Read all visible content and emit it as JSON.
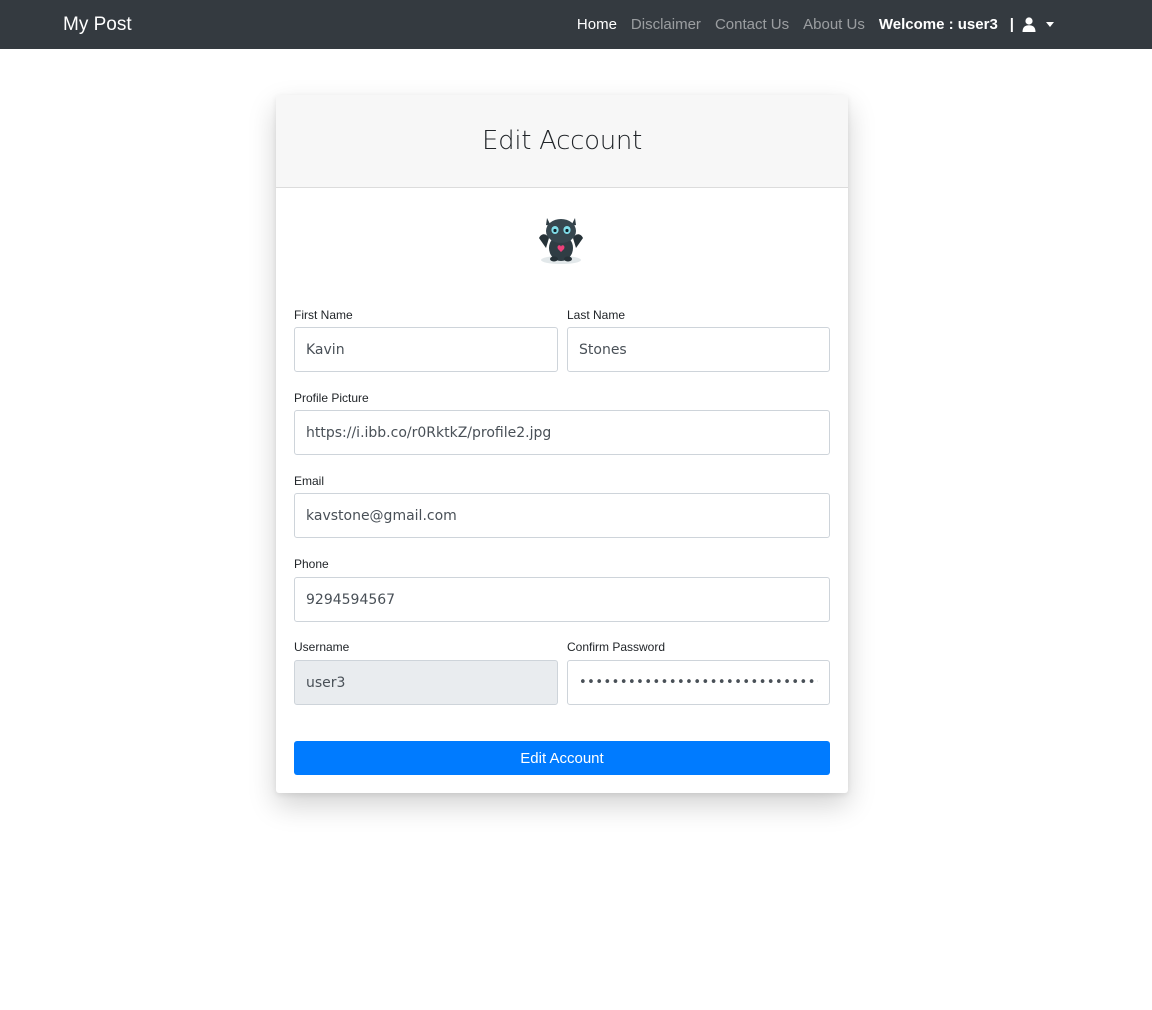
{
  "nav": {
    "brand": "My Post",
    "links": [
      "Home",
      "Disclaimer",
      "Contact Us",
      "About Us"
    ],
    "welcome": "Welcome : user3",
    "separator": "|"
  },
  "card": {
    "title": "Edit Account",
    "fields": {
      "first_name": {
        "label": "First Name",
        "value": "Kavin"
      },
      "last_name": {
        "label": "Last Name",
        "value": "Stones"
      },
      "profile_picture": {
        "label": "Profile Picture",
        "value": "https://i.ibb.co/r0RktkZ/profile2.jpg"
      },
      "email": {
        "label": "Email",
        "value": "kavstone@gmail.com"
      },
      "phone": {
        "label": "Phone",
        "value": "9294594567"
      },
      "username": {
        "label": "Username",
        "value": "user3"
      },
      "confirm_password": {
        "label": "Confirm Password",
        "value": "••••••••••••••••••••••••••••••••••••••••"
      }
    },
    "submit_label": "Edit Account"
  },
  "colors": {
    "navbar": "#343a40",
    "primary": "#007bff",
    "readonly_bg": "#e9ecef"
  }
}
